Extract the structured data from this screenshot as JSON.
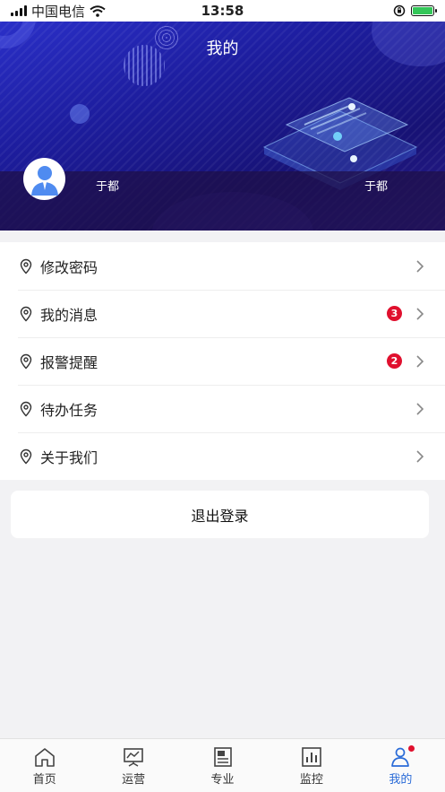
{
  "status_bar": {
    "carrier": "中国电信",
    "time": "13:58"
  },
  "header": {
    "title": "我的",
    "user_left": "于都",
    "user_right": "于都"
  },
  "menu": [
    {
      "label": "修改密码",
      "badge": ""
    },
    {
      "label": "我的消息",
      "badge": "3"
    },
    {
      "label": "报警提醒",
      "badge": "2"
    },
    {
      "label": "待办任务",
      "badge": ""
    },
    {
      "label": "关于我们",
      "badge": ""
    }
  ],
  "logout_label": "退出登录",
  "tabs": [
    {
      "label": "首页",
      "icon": "home-icon"
    },
    {
      "label": "运营",
      "icon": "presentation-icon"
    },
    {
      "label": "专业",
      "icon": "document-icon"
    },
    {
      "label": "监控",
      "icon": "bar-chart-icon"
    },
    {
      "label": "我的",
      "icon": "person-icon",
      "active": true
    }
  ],
  "colors": {
    "accent": "#2a6bd8",
    "badge": "#e0102e",
    "banner": "#1d1d9e"
  }
}
